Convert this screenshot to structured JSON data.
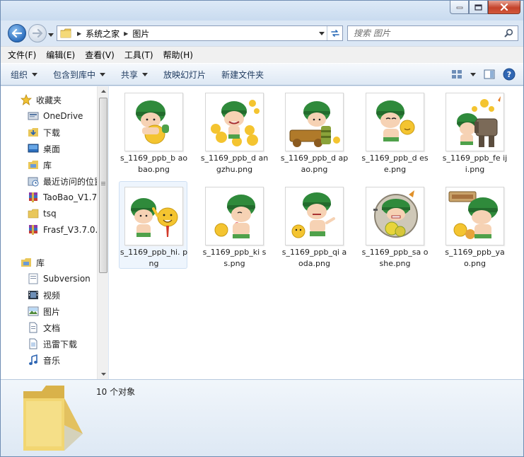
{
  "window": {
    "controls": {
      "minimize": "minimize",
      "maximize": "maximize",
      "close": "close"
    }
  },
  "address_bar": {
    "breadcrumbs": [
      "系统之家",
      "图片"
    ]
  },
  "search": {
    "placeholder": "搜索 图片"
  },
  "menu_bar": {
    "items": [
      "文件(F)",
      "编辑(E)",
      "查看(V)",
      "工具(T)",
      "帮助(H)"
    ]
  },
  "command_bar": {
    "items": [
      {
        "label": "组织",
        "dropdown": true
      },
      {
        "label": "包含到库中",
        "dropdown": true
      },
      {
        "label": "共享",
        "dropdown": true
      },
      {
        "label": "放映幻灯片",
        "dropdown": false
      },
      {
        "label": "新建文件夹",
        "dropdown": false
      }
    ]
  },
  "nav_pane": {
    "favorites_header": "收藏夹",
    "favorites": [
      {
        "label": "OneDrive",
        "icon": "onedrive-icon"
      },
      {
        "label": "下载",
        "icon": "download-folder-icon"
      },
      {
        "label": "桌面",
        "icon": "desktop-icon"
      },
      {
        "label": "库",
        "icon": "library-icon"
      },
      {
        "label": "最近访问的位置",
        "icon": "recent-places-icon"
      },
      {
        "label": "TaoBao_V1.7",
        "icon": "winrar-archive-icon"
      },
      {
        "label": "tsq",
        "icon": "folder-icon"
      },
      {
        "label": "Frasf_V3.7.0.0",
        "icon": "winrar-archive-icon"
      }
    ],
    "libraries_header": "库",
    "libraries": [
      {
        "label": "Subversion",
        "icon": "subversion-icon"
      },
      {
        "label": "视频",
        "icon": "video-library-icon"
      },
      {
        "label": "图片",
        "icon": "picture-library-icon"
      },
      {
        "label": "文档",
        "icon": "document-library-icon"
      },
      {
        "label": "迅雷下载",
        "icon": "thunder-download-icon"
      },
      {
        "label": "音乐",
        "icon": "music-library-icon"
      }
    ]
  },
  "files": [
    {
      "name": "s_1169_ppb_baobao.png",
      "display": "s_1169_ppb_b aobao.png",
      "selected": false
    },
    {
      "name": "s_1169_ppb_dangzhu.png",
      "display": "s_1169_ppb_d angzhu.png",
      "selected": false
    },
    {
      "name": "s_1169_ppb_dapao.png",
      "display": "s_1169_ppb_d apao.png",
      "selected": false
    },
    {
      "name": "s_1169_ppb_dese.png",
      "display": "s_1169_ppb_d ese.png",
      "selected": false
    },
    {
      "name": "s_1169_ppb_feiji.png",
      "display": "s_1169_ppb_fe iji.png",
      "selected": false
    },
    {
      "name": "s_1169_ppb_hi.png",
      "display": "s_1169_ppb_hi. png",
      "selected": true
    },
    {
      "name": "s_1169_ppb_kiss.png",
      "display": "s_1169_ppb_ki ss.png",
      "selected": false
    },
    {
      "name": "s_1169_ppb_qiaoda.png",
      "display": "s_1169_ppb_qi aoda.png",
      "selected": false
    },
    {
      "name": "s_1169_ppb_saoshe.png",
      "display": "s_1169_ppb_sa oshe.png",
      "selected": false
    },
    {
      "name": "s_1169_ppb_yao.png",
      "display": "s_1169_ppb_ya o.png",
      "selected": false
    }
  ],
  "details": {
    "count": "10 个对象"
  },
  "colors": {
    "accent": "#2d6fbe",
    "helmet": "#2f8a3b",
    "selection": "#eef5fd"
  }
}
